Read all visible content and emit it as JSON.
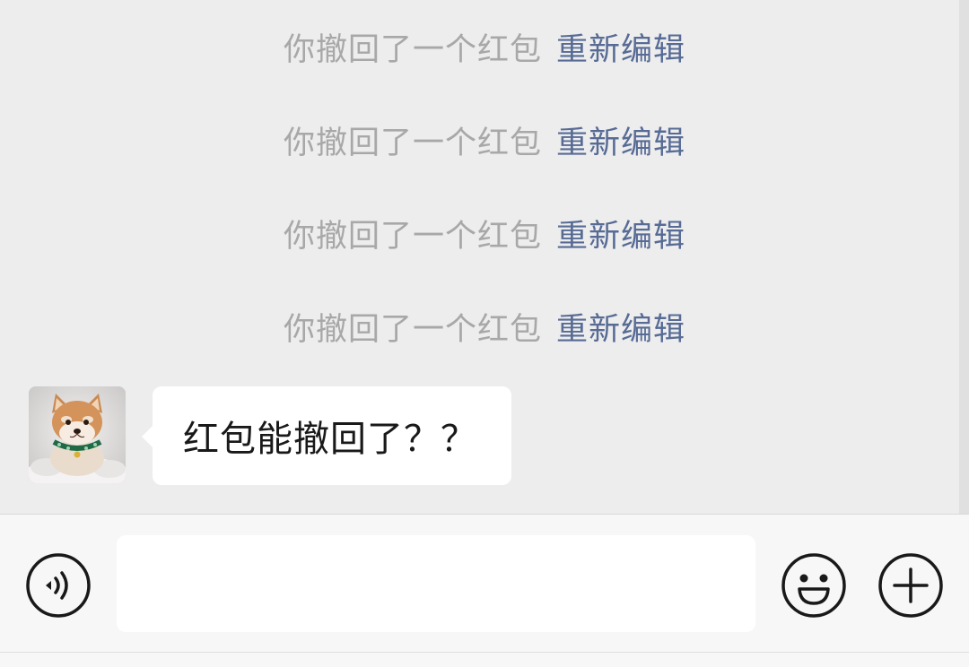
{
  "notices": [
    {
      "text": "你撤回了一个红包",
      "link": "重新编辑"
    },
    {
      "text": "你撤回了一个红包",
      "link": "重新编辑"
    },
    {
      "text": "你撤回了一个红包",
      "link": "重新编辑"
    },
    {
      "text": "你撤回了一个红包",
      "link": "重新编辑"
    }
  ],
  "message": {
    "text": "红包能撤回了？？",
    "avatar_icon": "shiba-dog-avatar"
  },
  "input_bar": {
    "placeholder": "",
    "voice_icon": "voice-icon",
    "emoji_icon": "emoji-icon",
    "plus_icon": "plus-icon"
  },
  "colors": {
    "chat_background": "#ededed",
    "notice_text": "#a8a8a8",
    "link": "#576b95",
    "bubble": "#ffffff",
    "input_bar": "#f7f7f7"
  }
}
